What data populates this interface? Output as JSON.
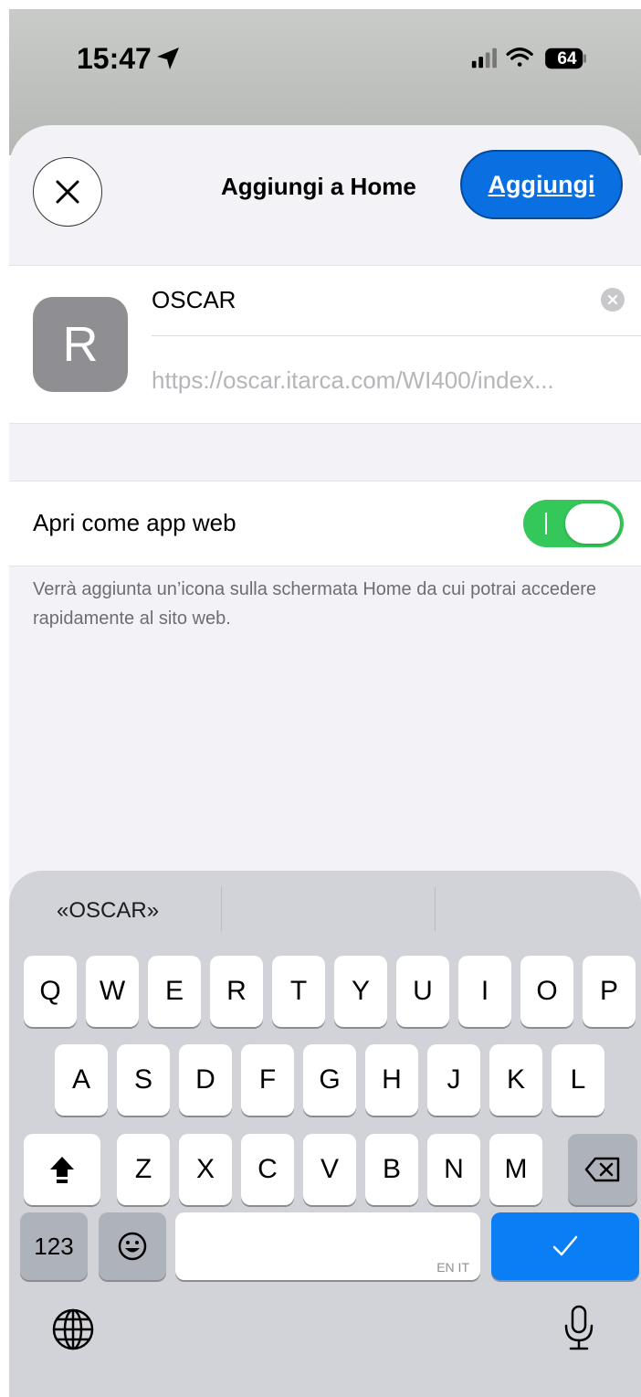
{
  "status_bar": {
    "time": "15:47",
    "battery": "64"
  },
  "sheet": {
    "title": "Aggiungi a Home",
    "add_label": "Aggiungi",
    "name_value": "OSCAR",
    "url_value": "https://oscar.itarca.com/WI400/index...",
    "icon_letter": "R",
    "webapp_label": "Apri come app web",
    "webapp_on": true,
    "toggle_mark": "I",
    "footnote": "Verrà aggiunta un’icona sulla schermata Home da cui potrai accedere rapidamente al sito web."
  },
  "keyboard": {
    "suggestions": [
      "«OSCAR»",
      "",
      ""
    ],
    "row1": [
      "Q",
      "W",
      "E",
      "R",
      "T",
      "Y",
      "U",
      "I",
      "O",
      "P"
    ],
    "row2": [
      "A",
      "S",
      "D",
      "F",
      "G",
      "H",
      "J",
      "K",
      "L"
    ],
    "row3": [
      "Z",
      "X",
      "C",
      "V",
      "B",
      "N",
      "M"
    ],
    "numbers_label": "123",
    "space_lang": "EN IT",
    "colors": {
      "accent": "#0a7ff5",
      "toggle": "#34c759"
    }
  }
}
